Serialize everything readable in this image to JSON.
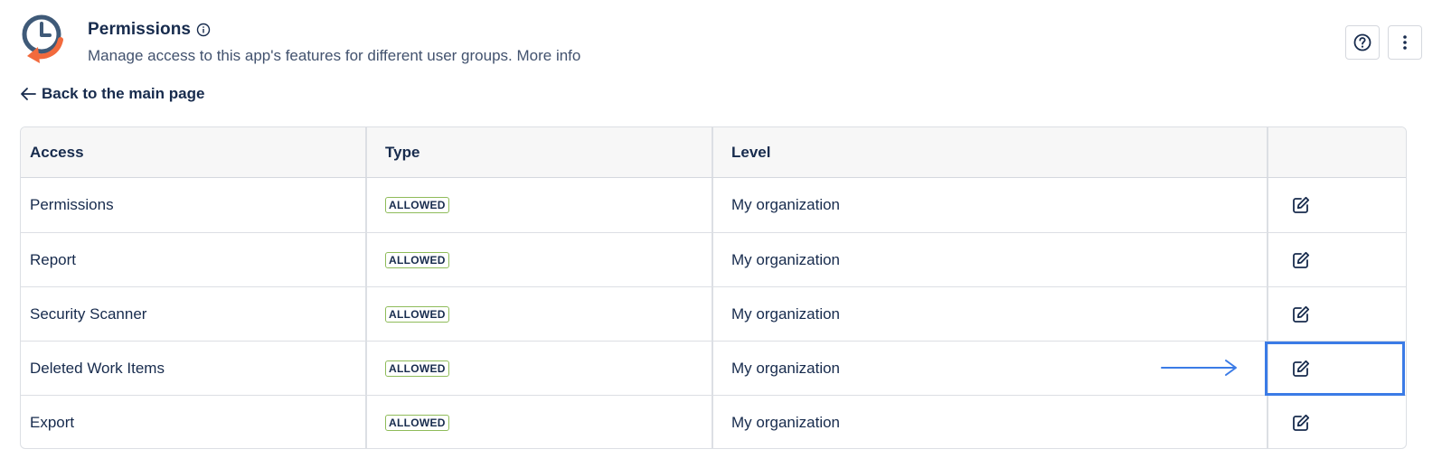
{
  "header": {
    "title": "Permissions",
    "subtitle_text": "Manage access to this app's features for different user groups.",
    "more_info_label": "More info"
  },
  "nav": {
    "back_label": "Back to the main page"
  },
  "table": {
    "columns": [
      "Access",
      "Type",
      "Level",
      ""
    ],
    "rows": [
      {
        "access": "Permissions",
        "type": "ALLOWED",
        "level": "My organization"
      },
      {
        "access": "Report",
        "type": "ALLOWED",
        "level": "My organization"
      },
      {
        "access": "Security Scanner",
        "type": "ALLOWED",
        "level": "My organization"
      },
      {
        "access": "Deleted Work Items",
        "type": "ALLOWED",
        "level": "My organization"
      },
      {
        "access": "Export",
        "type": "ALLOWED",
        "level": "My organization"
      }
    ]
  },
  "icons": {
    "logo": "clock-arrow-logo",
    "info": "info-icon",
    "help": "question-circle-icon",
    "more": "vertical-dots-icon",
    "back": "arrow-left-icon",
    "edit": "edit-pencil-icon"
  },
  "colors": {
    "logo_blue": "#3f5a78",
    "logo_orange": "#f26a3d",
    "badge_border": "#8fbc5a",
    "highlight": "#3b7be6",
    "text": "#172b4d"
  }
}
